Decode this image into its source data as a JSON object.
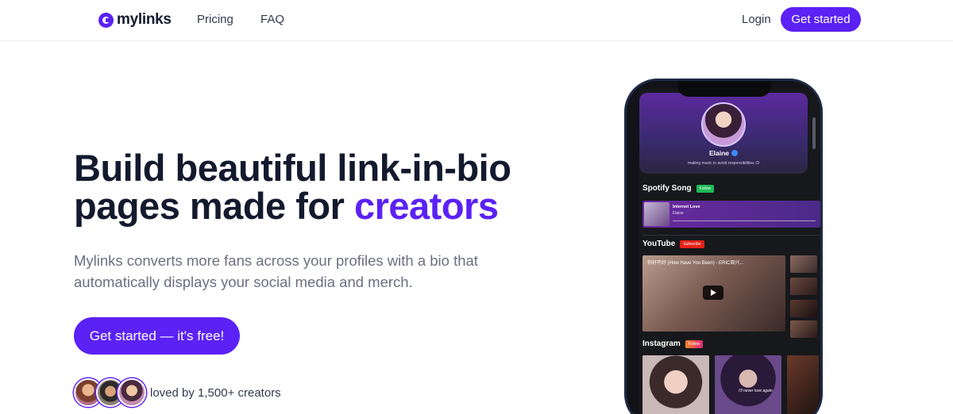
{
  "nav": {
    "logo_text": "mylinks",
    "pricing": "Pricing",
    "faq": "FAQ",
    "login": "Login",
    "cta": "Get started"
  },
  "hero": {
    "headline_line1": "Build beautiful link-in-bio",
    "headline_line2_prefix": "pages made for ",
    "headline_accent": "creators",
    "subtext": "Mylinks converts more fans across your profiles with a bio that automatically displays your social media and merch.",
    "cta": "Get started — it's free!",
    "social_proof": "loved by 1,500+ creators"
  },
  "phone": {
    "profile_name": "Elaine",
    "profile_bio": "making music to avoid responsibilities :D",
    "spotify": {
      "title": "Spotify Song",
      "badge": "Follow",
      "track_name": "Internet Love",
      "track_artist": "Elaine"
    },
    "youtube": {
      "title": "YouTube",
      "badge": "Subscribe",
      "video_caption": "你好不好 (How Have You Been) - ERIC周兴..."
    },
    "instagram": {
      "title": "Instagram",
      "badge": "Follow",
      "caption": "I'll never love again"
    }
  },
  "colors": {
    "brand": "#5b21f5",
    "heading": "#141a2e",
    "body_text": "#6b7080"
  }
}
